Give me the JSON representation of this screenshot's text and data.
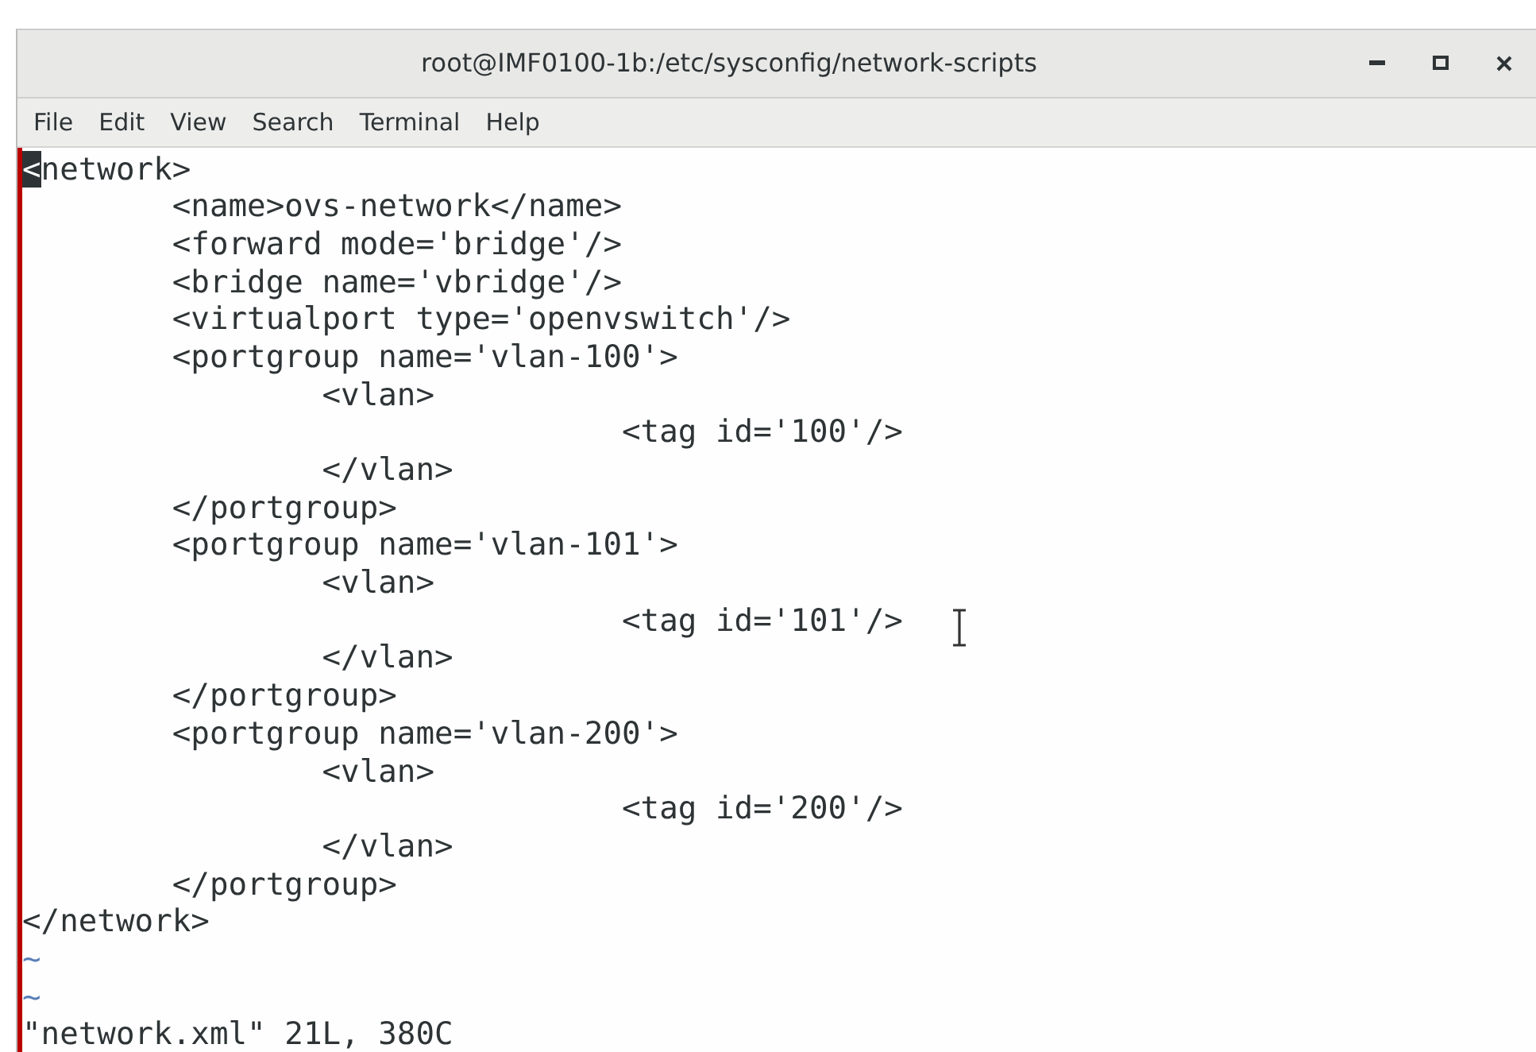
{
  "window": {
    "title": "root@IMF0100-1b:/etc/sysconfig/network-scripts"
  },
  "menu": [
    "File",
    "Edit",
    "View",
    "Search",
    "Terminal",
    "Help"
  ],
  "terminal": {
    "lines": [
      {
        "kind": "text",
        "text": "<network>",
        "cursor_at_start": true
      },
      {
        "kind": "text",
        "text": "\t<name>ovs-network</name>",
        "cursor_at_start": false
      },
      {
        "kind": "text",
        "text": "\t<forward mode='bridge'/>",
        "cursor_at_start": false
      },
      {
        "kind": "text",
        "text": "\t<bridge name='vbridge'/>",
        "cursor_at_start": false
      },
      {
        "kind": "text",
        "text": "\t<virtualport type='openvswitch'/>",
        "cursor_at_start": false
      },
      {
        "kind": "text",
        "text": "\t<portgroup name='vlan-100'>",
        "cursor_at_start": false
      },
      {
        "kind": "text",
        "text": "\t\t<vlan>",
        "cursor_at_start": false
      },
      {
        "kind": "text",
        "text": "\t\t\t\t<tag id='100'/>",
        "cursor_at_start": false
      },
      {
        "kind": "text",
        "text": "\t\t</vlan>",
        "cursor_at_start": false
      },
      {
        "kind": "text",
        "text": "\t</portgroup>",
        "cursor_at_start": false
      },
      {
        "kind": "text",
        "text": "\t<portgroup name='vlan-101'>",
        "cursor_at_start": false
      },
      {
        "kind": "text",
        "text": "\t\t<vlan>",
        "cursor_at_start": false
      },
      {
        "kind": "text",
        "text": "\t\t\t\t<tag id='101'/>",
        "cursor_at_start": false
      },
      {
        "kind": "text",
        "text": "\t\t</vlan>",
        "cursor_at_start": false
      },
      {
        "kind": "text",
        "text": "\t</portgroup>",
        "cursor_at_start": false
      },
      {
        "kind": "text",
        "text": "\t<portgroup name='vlan-200'>",
        "cursor_at_start": false
      },
      {
        "kind": "text",
        "text": "\t\t<vlan>",
        "cursor_at_start": false
      },
      {
        "kind": "text",
        "text": "\t\t\t\t<tag id='200'/>",
        "cursor_at_start": false
      },
      {
        "kind": "text",
        "text": "\t\t</vlan>",
        "cursor_at_start": false
      },
      {
        "kind": "text",
        "text": "\t</portgroup>",
        "cursor_at_start": false
      },
      {
        "kind": "text",
        "text": "</network>",
        "cursor_at_start": false
      },
      {
        "kind": "tilde",
        "text": "~"
      },
      {
        "kind": "tilde",
        "text": "~"
      }
    ],
    "status_line": "\"network.xml\" 21L, 380C"
  }
}
